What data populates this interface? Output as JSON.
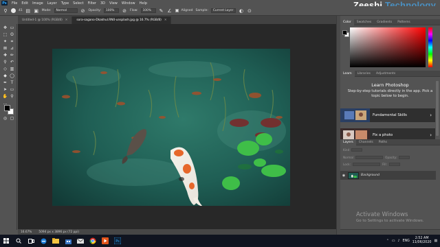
{
  "brand": {
    "text_1": "Zeeshi",
    "text_2": "Technology"
  },
  "app": {
    "logo": "Ps"
  },
  "menu": [
    "File",
    "Edit",
    "Image",
    "Layer",
    "Type",
    "Select",
    "Filter",
    "3D",
    "View",
    "Window",
    "Help"
  ],
  "options": {
    "brush_size": "41",
    "mode_label": "Mode:",
    "mode_value": "Normal",
    "opacity_label": "Opacity:",
    "opacity_value": "100%",
    "flow_label": "Flow:",
    "flow_value": "100%",
    "aligned_label": "Aligned",
    "sample_label": "Sample:",
    "sample_value": "Current Layer"
  },
  "tabs": [
    {
      "label": "Untitled-1 @ 100% (RGB/8)",
      "active": false
    },
    {
      "label": "sora-sagano-Dkakhul.RN0-unsplash.jpg @ 16.7% (RGB/8)",
      "active": true
    }
  ],
  "status": {
    "zoom": "16.67%",
    "doc_info": "5094 px x 3896 px (72 ppi)"
  },
  "color_panel": {
    "tabs": [
      "Color",
      "Swatches",
      "Gradients",
      "Patterns"
    ],
    "accent_color": "#ff0000"
  },
  "learn_panel": {
    "tabs": [
      "Learn",
      "Libraries",
      "Adjustments"
    ],
    "title": "Learn Photoshop",
    "description": "Step-by-step tutorials directly in the app. Pick a topic below to begin.",
    "cards": [
      {
        "label": "Fundamental Skills"
      },
      {
        "label": "Fix a photo"
      }
    ]
  },
  "layers_panel": {
    "tabs": [
      "Layers",
      "Channels",
      "Paths"
    ],
    "kind_label": "Kind",
    "mode_label": "Normal",
    "opacity_label": "Opacity:",
    "lock_label": "Lock:",
    "fill_label": "Fill:",
    "layer_name": "Background"
  },
  "watermark": {
    "line1": "Activate Windows",
    "line2": "Go to Settings to activate Windows."
  },
  "taskbar": {
    "lang": "ENG",
    "time": "2:52 AM",
    "date": "11/06/2020",
    "icons": [
      "windows-start-icon",
      "search-icon",
      "task-view-icon",
      "edge-icon",
      "file-explorer-icon",
      "store-icon",
      "mail-icon",
      "chrome-icon",
      "media-icon",
      "photoshop-icon"
    ]
  }
}
